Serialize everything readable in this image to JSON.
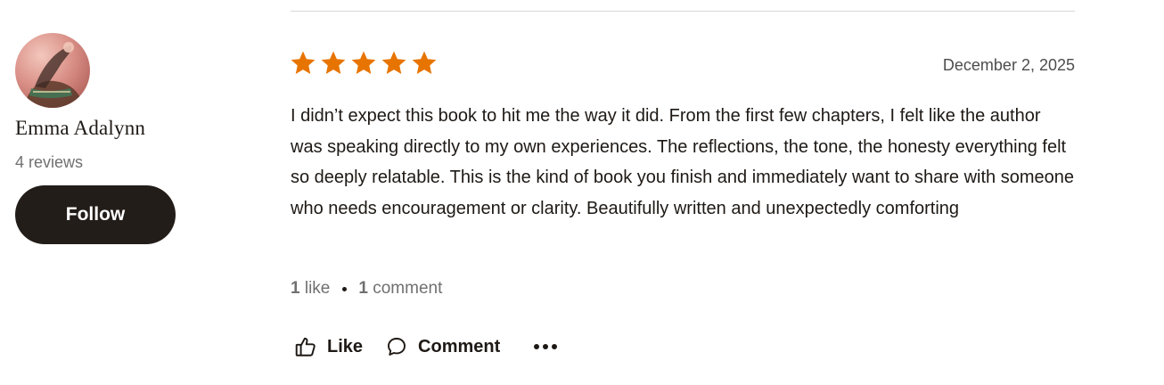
{
  "reviewer": {
    "name": "Emma Adalynn",
    "review_count": "4 reviews",
    "follow_label": "Follow"
  },
  "review": {
    "rating": 5,
    "rating_max": 5,
    "date": "December 2, 2025",
    "text": "I didn’t expect this book to hit me the way it did. From the first few chapters, I felt like the author was speaking directly to my own experiences. The reflections, the tone, the honesty everything felt so deeply relatable. This is the kind of book you finish and immediately want to share with someone who needs encouragement or clarity. Beautifully written and unexpectedly comforting"
  },
  "stats": {
    "likes_num": "1",
    "likes_label": "like",
    "comments_num": "1",
    "comments_label": "comment"
  },
  "actions": {
    "like_label": "Like",
    "comment_label": "Comment"
  },
  "icons": {
    "star": "star-icon",
    "like": "thumbs-up-icon",
    "comment": "speech-bubble-icon",
    "more": "more-dots-icon"
  },
  "colors": {
    "star": "#e87400",
    "follow_bg": "#231d19",
    "text": "#1e1915",
    "muted": "#707070"
  }
}
